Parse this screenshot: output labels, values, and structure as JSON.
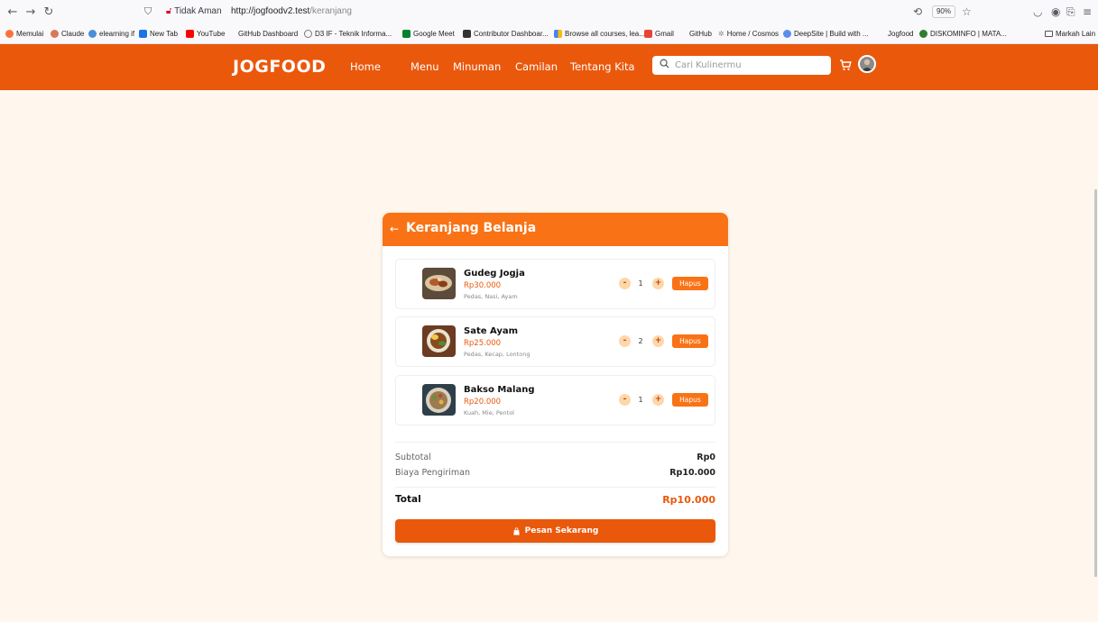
{
  "browser": {
    "security_label": "Tidak Aman",
    "url_host": "http://jogfoodv2.test",
    "url_path": "/keranjang",
    "zoom": "90%",
    "bookmarks": [
      {
        "label": "Memulai",
        "color": "#ff7139"
      },
      {
        "label": "Claude",
        "color": "#d97757"
      },
      {
        "label": "elearning if",
        "color": "#4a90d9"
      },
      {
        "label": "New Tab",
        "color": "#1a73e8"
      },
      {
        "label": "YouTube",
        "color": "#ff0000"
      },
      {
        "label": "GitHub Dashboard",
        "color": "#ffffff"
      },
      {
        "label": "D3 IF - Teknik Informa...",
        "color": "#777777"
      },
      {
        "label": "Google Meet",
        "color": "#00832d"
      },
      {
        "label": "Contributor Dashboar...",
        "color": "#333333"
      },
      {
        "label": "Browse all courses, lea...",
        "color": "#4285f4"
      },
      {
        "label": "Gmail",
        "color": "#ea4335"
      },
      {
        "label": "GitHub",
        "color": "#ffffff"
      },
      {
        "label": "Home / Cosmos",
        "color": "#888888"
      },
      {
        "label": "DeepSite | Build with ...",
        "color": "#5b8def"
      },
      {
        "label": "Jogfood",
        "color": "#ffffff"
      },
      {
        "label": "DISKOMINFO | MATA...",
        "color": "#2e7d32"
      }
    ],
    "other_bookmarks": "Markah Lain"
  },
  "header": {
    "logo": "JOGFOOD",
    "nav": [
      "Home",
      "Menu",
      "Minuman",
      "Camilan",
      "Tentang Kita"
    ],
    "search_placeholder": "Cari Kulinermu"
  },
  "cart": {
    "title": "Keranjang Belanja",
    "items": [
      {
        "name": "Gudeg Jogja",
        "price": "Rp30.000",
        "desc": "Pedas, Nasi, Ayam",
        "qty": "1",
        "delete_label": "Hapus",
        "minus": "-",
        "plus": "+"
      },
      {
        "name": "Sate Ayam",
        "price": "Rp25.000",
        "desc": "Pedas, Kecap, Lontong",
        "qty": "2",
        "delete_label": "Hapus",
        "minus": "-",
        "plus": "+"
      },
      {
        "name": "Bakso Malang",
        "price": "Rp20.000",
        "desc": "Kuah, Mie, Pentol",
        "qty": "1",
        "delete_label": "Hapus",
        "minus": "-",
        "plus": "+"
      }
    ],
    "subtotal_label": "Subtotal",
    "subtotal_value": "Rp0",
    "shipping_label": "Biaya Pengiriman",
    "shipping_value": "Rp10.000",
    "total_label": "Total",
    "total_value": "Rp10.000",
    "order_button": "Pesan Sekarang"
  },
  "colors": {
    "brand": "#ea580c",
    "card_header": "#f97316",
    "page_background": "#fff7ed"
  }
}
